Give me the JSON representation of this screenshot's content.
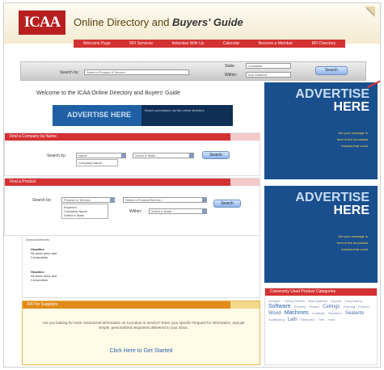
{
  "header": {
    "logo": "ICAA",
    "title_plain": "Online Directory and",
    "title_bold": "Buyers' Guide"
  },
  "nav": {
    "items": [
      "Welcome Page",
      "RFI Services",
      "Advertise With Us",
      "Calendar",
      "Become a Member",
      "RFI Directory"
    ]
  },
  "search": {
    "search_by_label": "Search by:",
    "search_by_value": "Select a Product & Service...",
    "state_label": "State:",
    "state_value": "Louisiana",
    "within_label": "Within:",
    "within_value": "Any Distance",
    "button": "Search"
  },
  "welcome": {
    "text": "Welcome to the ICAA Online Directory and Buyers' Guide",
    "banner_text": "ADVERTISE HERE",
    "banner_sub": "Reach purchasers via the online directory"
  },
  "find_company": {
    "header": "Find a Company by Name",
    "search_label": "Search by:",
    "select_value": "Name",
    "select2_value": "Select a State...",
    "dropdown_option": "Company Name",
    "button": "Search"
  },
  "find_product": {
    "header": "Find a Product",
    "search_label": "Search by:",
    "select_value": "Product or Service",
    "select2_value": "Select a Product/Service...",
    "within_label": "Within:",
    "within_value": "Select a State...",
    "dropdown_options": [
      "Keyword",
      "Company Name",
      "Select a State"
    ],
    "button": "Search"
  },
  "announcements": {
    "title": "Announcements",
    "items": [
      {
        "headline": "Headline",
        "line1": "Sit amet dolor sed",
        "line2": "Consectetur"
      },
      {
        "headline": "Headline",
        "line1": "Sit amet dolor sed",
        "line2": "Consectetur"
      }
    ]
  },
  "get_started": {
    "header": "RFI for Suppliers",
    "desc": "Are you looking for more customized information on a product or service? Enter your specific Request for Information, and get simple, personalized responses delivered to your inbox.",
    "cta": "Click Here to Get Started"
  },
  "ads": [
    {
      "line1": "ADVERTISE",
      "line2": "HERE",
      "sub1": "Get your message in",
      "sub2": "front of the Acoustical",
      "sub3": "industry that count"
    },
    {
      "line1": "ADVERTISE",
      "line2": "HERE",
      "sub1": "Get your message in",
      "sub2": "front of the Acoustical",
      "sub3": "industry that count"
    }
  ],
  "categories": {
    "header": "Commonly Used Product Categories",
    "tags": [
      "Acoustic",
      "Ceiling Panels",
      "Wall Systems",
      "Drywall",
      "Fireproofing",
      "Software",
      "Framing",
      "Plaster",
      "Ceilings",
      "Flooring",
      "Exterior",
      "Wood",
      "Machines",
      "Coatings",
      "Insulation",
      "Sealants",
      "Scaffolding",
      "Lath",
      "Fasteners",
      "Trim",
      "more"
    ]
  },
  "colors": {
    "brand_red": "#d43232",
    "ad_blue": "#1a4f8d",
    "accent_yellow": "#ffd24a"
  }
}
